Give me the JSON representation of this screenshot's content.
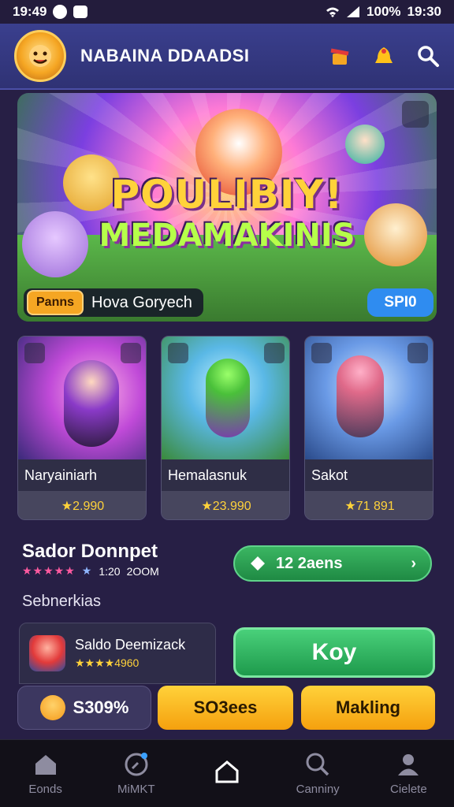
{
  "status_bar": {
    "time_left": "19:49",
    "battery": "100%",
    "time_right": "19:30"
  },
  "app_bar": {
    "title": "NABAINA DDAADSI"
  },
  "hero": {
    "title": "POULIBIY!",
    "subtitle": "MEDAMAKINIS",
    "tag": "Panns",
    "caption": "Hova Goryech",
    "button": "SPI0"
  },
  "cards": [
    {
      "name": "Naryainiarh",
      "rating": "★2.990"
    },
    {
      "name": "Hemalasnuk",
      "rating": "★23.990"
    },
    {
      "name": "Sakot",
      "rating": "★71 891"
    }
  ],
  "section": {
    "title": "Sador Donnpet",
    "stars": "★★★★★",
    "stars_alt": "★",
    "count": "1:20",
    "downloads": "2OOM",
    "subheading": "Sebnerkias"
  },
  "cta_pill": {
    "label": "12 2aens",
    "arrow": "›"
  },
  "list_item": {
    "title": "Saldo Deemizack",
    "rating": "★★★★4960"
  },
  "buy_button": "Koy",
  "chips": [
    {
      "label": "S309%"
    },
    {
      "label": "SO3ees"
    },
    {
      "label": "Makling"
    }
  ],
  "bottom_nav": [
    {
      "label": "Eonds",
      "icon": "home-icon"
    },
    {
      "label": "MiMKT",
      "icon": "compass-icon"
    },
    {
      "label": "",
      "icon": "home-outline-icon"
    },
    {
      "label": "Canniny",
      "icon": "search-icon"
    },
    {
      "label": "Cielete",
      "icon": "profile-icon"
    }
  ]
}
